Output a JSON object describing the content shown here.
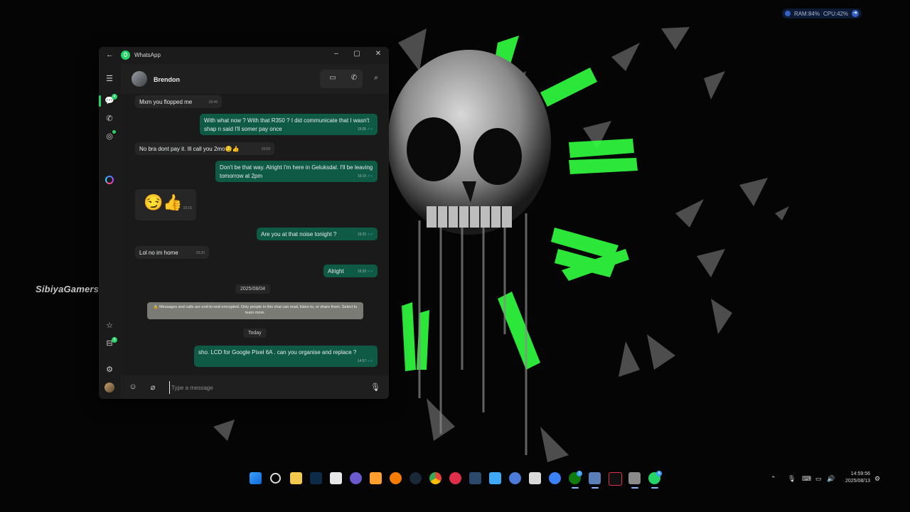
{
  "desktop": {
    "widget": {
      "ram": "RAM:84%",
      "cpu": "CPU:42%"
    },
    "watermark": "SibiyaGamers on Twitch"
  },
  "window": {
    "title": "WhatsApp",
    "controls": {
      "minimize": "–",
      "maximize": "▢",
      "close": "✕"
    }
  },
  "rail": {
    "chats_badge": "4",
    "status_badge": "",
    "archive_badge": "5"
  },
  "chat": {
    "contact_name": "Brendon",
    "messages": [
      {
        "dir": "in",
        "text": "Mxm you flopped me",
        "time": "18:49"
      },
      {
        "dir": "out",
        "text": "With what now ? With that R350 ? I did communicate that I wasn't shap n said I'll somer pay once",
        "time": "19:05"
      },
      {
        "dir": "in",
        "text": "No bra dont pay it. Ill call you 2mo😏👍",
        "time": "19:09"
      },
      {
        "dir": "out",
        "text": "Don't be that way. Alright I'm here in Geluksdal. I'll be leaving tomorrow at 2pm",
        "time": "19:15"
      },
      {
        "dir": "in",
        "text": "😏👍",
        "time": "19:15"
      },
      {
        "dir": "out",
        "text": "Are you at that noise tonight ?",
        "time": "19:20"
      },
      {
        "dir": "in",
        "text": "Lol no im home",
        "time": "19:20"
      },
      {
        "dir": "out",
        "text": "Alright",
        "time": "19:20"
      },
      {
        "dir": "out",
        "text": "sho. LCD for Google Pixel 6A . can you organise and replace ?",
        "time": "14:57"
      }
    ],
    "date_chip_1": "2025/08/04",
    "encryption_note": "🔒 Messages and calls are end-to-end encrypted. Only people in this chat can read, listen to, or share them. Select to learn more.",
    "date_chip_2": "Today"
  },
  "composer": {
    "placeholder": "Type a message"
  },
  "tray": {
    "time": "14:59:56",
    "date": "2025/08/13",
    "xbox_badge": "1",
    "whatsapp_badge": "4"
  },
  "colors": {
    "accent": "#25d366",
    "outgoing_bubble": "#0e5a44",
    "incoming_bubble": "#262626"
  }
}
